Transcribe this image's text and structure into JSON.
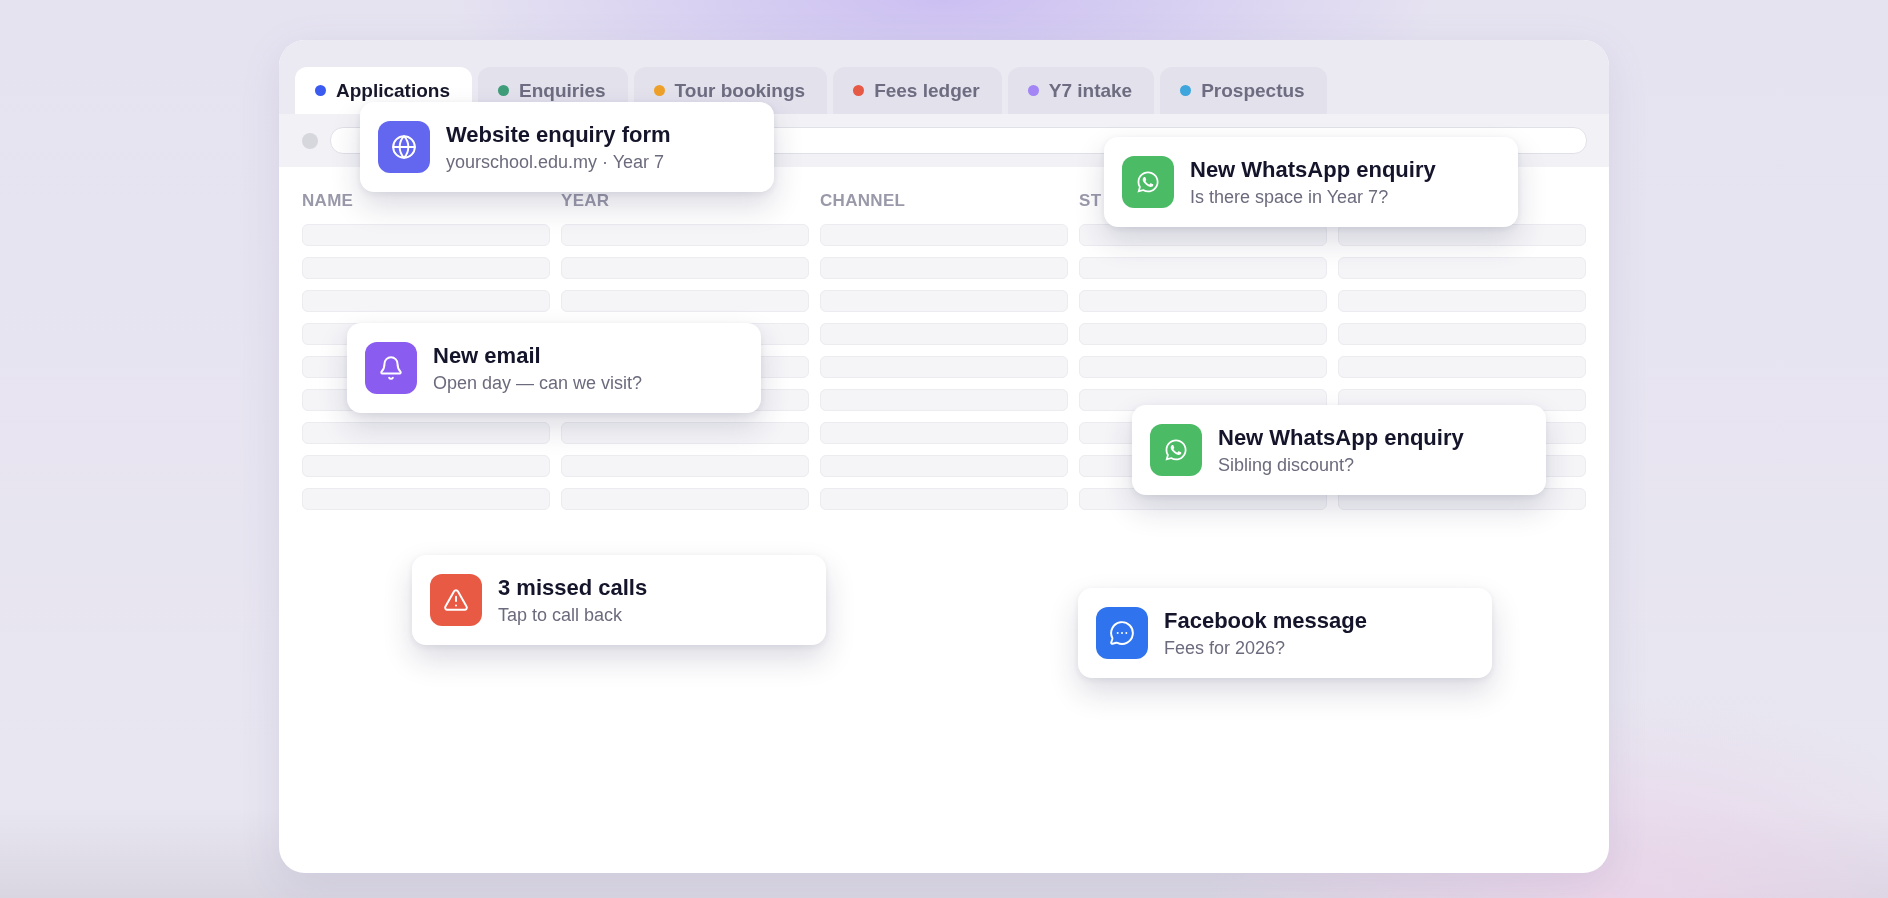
{
  "tabs": [
    {
      "label": "Applications",
      "color": "#3b5bf0",
      "selected": true
    },
    {
      "label": "Enquiries",
      "color": "#3f9e7a",
      "selected": false
    },
    {
      "label": "Tour bookings",
      "color": "#eea12a",
      "selected": false
    },
    {
      "label": "Fees ledger",
      "color": "#e65a45",
      "selected": false
    },
    {
      "label": "Y7 intake",
      "color": "#a385f5",
      "selected": false
    },
    {
      "label": "Prospectus",
      "color": "#3ea6dc",
      "selected": false
    }
  ],
  "table": {
    "columns": [
      "NAME",
      "YEAR",
      "CHANNEL",
      "ST"
    ]
  },
  "notifications": [
    {
      "kind": "web",
      "color": "#6366ee",
      "title": "Website enquiry form",
      "subtitle": "yourschool.edu.my · Year 7"
    },
    {
      "kind": "whatsapp",
      "color": "#4cbb66",
      "title": "New WhatsApp enquiry",
      "subtitle": "Is there space in Year 7?"
    },
    {
      "kind": "email",
      "color": "#8b5cf0",
      "title": "New email",
      "subtitle": "Open day — can we visit?"
    },
    {
      "kind": "whatsapp",
      "color": "#4cbb66",
      "title": "New WhatsApp enquiry",
      "subtitle": "Sibling discount?"
    },
    {
      "kind": "alert",
      "color": "#e95a44",
      "title": "3 missed calls",
      "subtitle": "Tap to call back"
    },
    {
      "kind": "messenger",
      "color": "#2f74ee",
      "title": "Facebook message",
      "subtitle": "Fees for 2026?"
    }
  ]
}
